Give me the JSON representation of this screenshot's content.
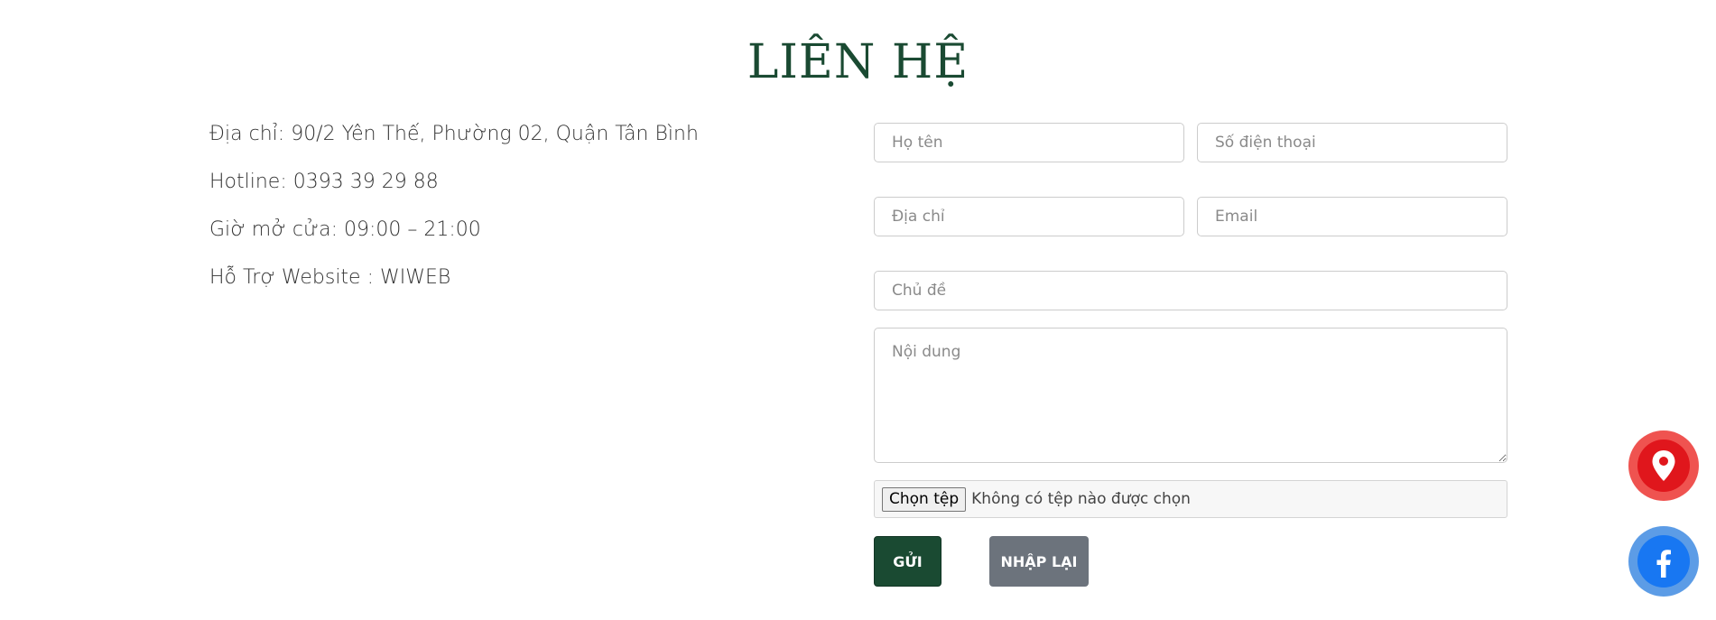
{
  "page": {
    "title": "LIÊN HỆ"
  },
  "contact_info": {
    "address": "Địa chỉ: 90/2 Yên Thế, Phường 02, Quận Tân Bình",
    "hotline": "Hotline: 0393 39 29 88",
    "hours": "Giờ mở cửa: 09:00 – 21:00",
    "support": "Hỗ Trợ Website : WIWEB"
  },
  "form": {
    "name_placeholder": "Họ tên",
    "phone_placeholder": "Số điện thoại",
    "address_placeholder": "Địa chỉ",
    "email_placeholder": "Email",
    "subject_placeholder": "Chủ đề",
    "message_placeholder": "Nội dung",
    "file_button_label": "Chọn tệp",
    "file_status": "Không có tệp nào được chọn",
    "submit_label": "GỬI",
    "reset_label": "NHẬP LẠI"
  },
  "floating_buttons": {
    "map_icon": "map-pin-icon",
    "facebook_icon": "facebook-icon"
  },
  "colors": {
    "brand_green": "#1a4a32",
    "reset_gray": "#6c737c",
    "map_red": "#e0161c",
    "facebook_blue": "#1877f2"
  }
}
